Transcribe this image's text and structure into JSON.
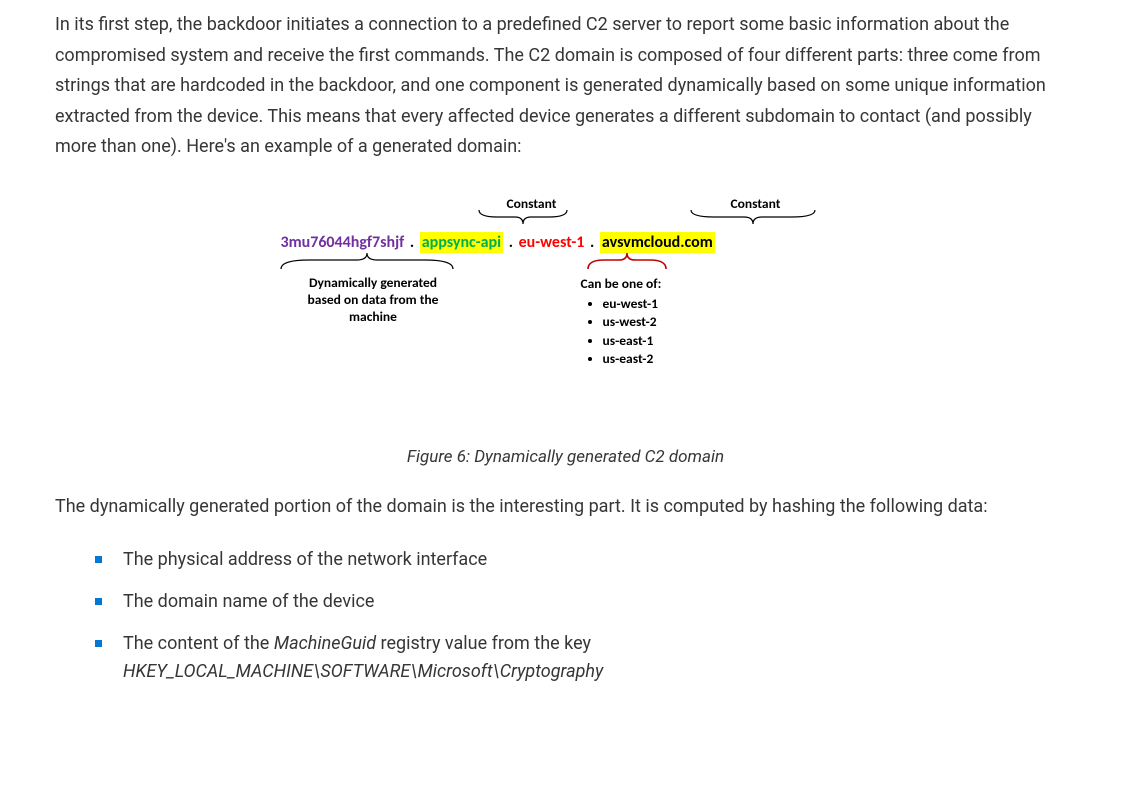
{
  "paragraph1": "In its first step, the backdoor initiates a connection to a predefined C2 server to report some basic information about the compromised system and receive the first commands. The C2 domain is composed of four different parts: three come from strings that are hardcoded in the backdoor, and one component is generated dynamically based on some unique information extracted from the device. This means that every affected device generates a different subdomain to contact (and possibly more than one). Here's an example of a generated domain:",
  "diagram": {
    "constant_label": "Constant",
    "dynamic_part": "3mu76044hgf7shjf",
    "api_part": "appsync-api",
    "region_part": "eu-west-1",
    "root_part": "avsvmcloud.com",
    "dot": ".",
    "dyn_caption_l1": "Dynamically generated",
    "dyn_caption_l2": "based on data from the",
    "dyn_caption_l3": "machine",
    "region_caption": "Can be one of:",
    "regions": {
      "r0": "eu-west-1",
      "r1": "us-west-2",
      "r2": "us-east-1",
      "r3": "us-east-2"
    }
  },
  "figure_caption": "Figure 6: Dynamically generated C2 domain",
  "paragraph2": "The dynamically generated portion of the domain is the interesting part. It is computed by hashing the following data:",
  "bullets": {
    "b0": "The physical address of the network interface",
    "b1": "The domain name of the device",
    "b2_pre": "The content of the ",
    "b2_ital": "MachineGuid",
    "b2_post": " registry value from the key ",
    "b2_key": "HKEY_LOCAL_MACHINE\\SOFTWARE\\Microsoft\\Cryptography"
  }
}
